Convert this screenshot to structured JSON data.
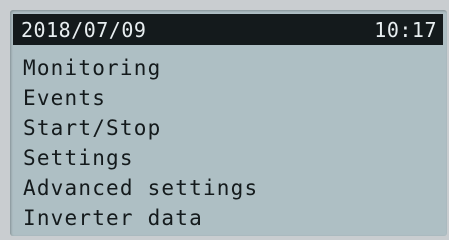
{
  "status_bar": {
    "date": "2018/07/09",
    "time": "10:17"
  },
  "menu": {
    "items": [
      {
        "label": "Monitoring"
      },
      {
        "label": "Events"
      },
      {
        "label": "Start/Stop"
      },
      {
        "label": "Settings"
      },
      {
        "label": "Advanced settings"
      },
      {
        "label": "Inverter data"
      }
    ]
  },
  "colors": {
    "screen_background": "#aebfc4",
    "status_bar_background": "#141a1c",
    "status_bar_text": "#e8eef0",
    "menu_text": "#141a1c"
  }
}
